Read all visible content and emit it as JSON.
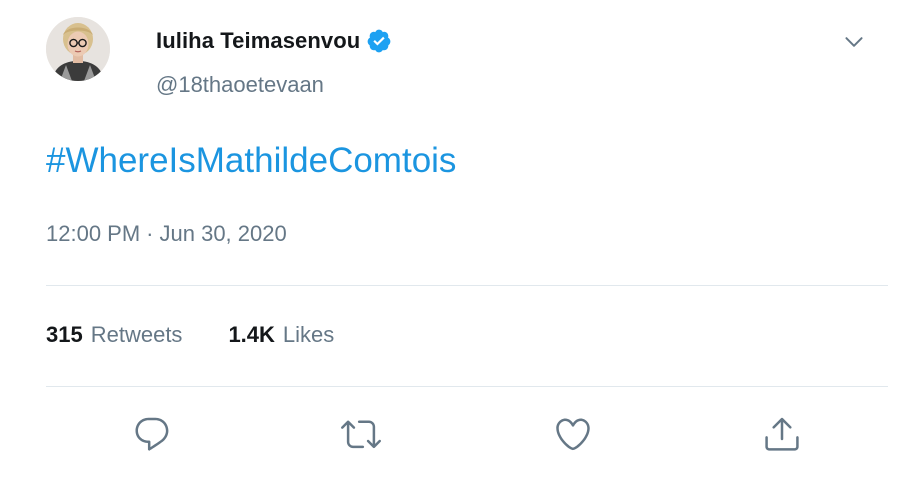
{
  "tweet": {
    "author": {
      "display_name": "Iuliha Teimasenvou",
      "handle": "@18thaoetevaan",
      "verified": true,
      "avatar_icon": "profile-photo"
    },
    "menu_icon": "chevron-down-icon",
    "text": {
      "hashtag": "#WhereIsMathildeComtois"
    },
    "time": "12:00 PM",
    "separator": "·",
    "date": "Jun 30, 2020",
    "stats": {
      "retweets_count": "315",
      "retweets_label": "Retweets",
      "likes_count": "1.4K",
      "likes_label": "Likes"
    },
    "actions": [
      {
        "name": "reply",
        "icon": "reply-icon"
      },
      {
        "name": "retweet",
        "icon": "retweet-icon"
      },
      {
        "name": "like",
        "icon": "heart-icon"
      },
      {
        "name": "share",
        "icon": "share-icon"
      }
    ]
  },
  "colors": {
    "link": "#1b95e0",
    "verified": "#1da1f2",
    "text_primary": "#14171a",
    "text_secondary": "#657786",
    "divider": "#e1e8ed"
  }
}
